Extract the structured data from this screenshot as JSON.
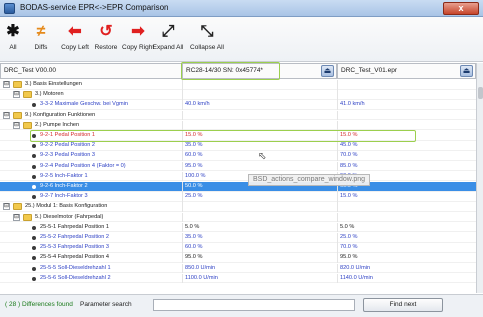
{
  "window": {
    "title": "BODAS-service EPR<->EPR Comparison",
    "close_glyph": "x"
  },
  "toolbar": {
    "buttons": [
      {
        "label": "All",
        "icon": "asterisk-icon",
        "glyph": "✱",
        "color": "#111111"
      },
      {
        "label": "Diffs",
        "icon": "not-equal-icon",
        "glyph": "≠",
        "color": "#e58a1b"
      },
      {
        "label": "Copy Left",
        "icon": "arrow-left-icon",
        "glyph": "⬅",
        "color": "#e02020"
      },
      {
        "label": "Restore",
        "icon": "restore-icon",
        "glyph": "↺",
        "color": "#e02020"
      },
      {
        "label": "Copy Right",
        "icon": "arrow-right-icon",
        "glyph": "➡",
        "color": "#e02020"
      },
      {
        "label": "Expand All",
        "icon": "expand-all-icon",
        "glyph": "⤢",
        "color": "#222222"
      },
      {
        "label": "Collapse All",
        "icon": "collapse-all-icon",
        "glyph": "⤡",
        "color": "#222222"
      }
    ]
  },
  "headers": {
    "tree": "DRC_Test V00.00",
    "left": "RC28-14/30 SN: 0x45774*",
    "right": "DRC_Test_V01.epr",
    "eject_glyph": "⏏"
  },
  "rows": [
    {
      "indent": 0,
      "kind": "group",
      "expander": "⊟",
      "label": "3.) Basis Einstellungen",
      "left": "",
      "right": "",
      "style": ""
    },
    {
      "indent": 1,
      "kind": "group",
      "expander": "⊟",
      "label": "3.) Motoren",
      "left": "",
      "right": "",
      "style": ""
    },
    {
      "indent": 2,
      "kind": "param",
      "label": "3-3-2 Maximale Geschw. bei Vgmin",
      "left": "40.0 km/h",
      "right": "41.0 km/h",
      "style": "blue"
    },
    {
      "indent": 0,
      "kind": "group",
      "expander": "⊟",
      "label": "9.) Konfiguration Funktionen",
      "left": "",
      "right": "",
      "style": ""
    },
    {
      "indent": 1,
      "kind": "group",
      "expander": "⊟",
      "label": "2.) Pumpe Inchen",
      "left": "",
      "right": "",
      "style": ""
    },
    {
      "indent": 2,
      "kind": "param",
      "label": "9-2-1 Pedal Position 1",
      "left": "15.0 %",
      "right": "15.0 %",
      "style": "red"
    },
    {
      "indent": 2,
      "kind": "param",
      "label": "9-2-2 Pedal Position 2",
      "left": "35.0 %",
      "right": "45.0 %",
      "style": "blue"
    },
    {
      "indent": 2,
      "kind": "param",
      "label": "9-2-3 Pedal Position 3",
      "left": "60.0 %",
      "right": "70.0 %",
      "style": "blue"
    },
    {
      "indent": 2,
      "kind": "param",
      "label": "9-2-4 Pedal Position 4 (Faktor = 0)",
      "left": "95.0 %",
      "right": "85.0 %",
      "style": "blue"
    },
    {
      "indent": 2,
      "kind": "param",
      "label": "9-2-5 Inch-Faktor 1",
      "left": "100.0 %",
      "right": "90.0 %",
      "style": "blue"
    },
    {
      "indent": 2,
      "kind": "param",
      "label": "9-2-6 Inch-Faktor 2",
      "left": "50.0 %",
      "right": "60.0 %",
      "style": "sel"
    },
    {
      "indent": 2,
      "kind": "param",
      "label": "9-2-7 Inch-Faktor 3",
      "left": "25.0 %",
      "right": "15.0 %",
      "style": "blue"
    },
    {
      "indent": 0,
      "kind": "group",
      "expander": "⊟",
      "label": "25.) Modul 1: Basis Konfiguration",
      "left": "",
      "right": "",
      "style": ""
    },
    {
      "indent": 1,
      "kind": "group",
      "expander": "⊟",
      "label": "5.) Dieselmotor (Fahrpedal)",
      "left": "",
      "right": "",
      "style": ""
    },
    {
      "indent": 2,
      "kind": "param",
      "label": "25-5-1 Fahrpedal Position 1",
      "left": "5.0 %",
      "right": "5.0 %",
      "style": ""
    },
    {
      "indent": 2,
      "kind": "param",
      "label": "25-5-2 Fahrpedal Position 2",
      "left": "35.0 %",
      "right": "25.0 %",
      "style": "blue"
    },
    {
      "indent": 2,
      "kind": "param",
      "label": "25-5-3 Fahrpedal Position 3",
      "left": "60.0 %",
      "right": "70.0 %",
      "style": "blue"
    },
    {
      "indent": 2,
      "kind": "param",
      "label": "25-5-4 Fahrpedal Position 4",
      "left": "95.0 %",
      "right": "95.0 %",
      "style": ""
    },
    {
      "indent": 2,
      "kind": "param",
      "label": "25-5-5 Soll-Dieseldrehzahl 1",
      "left": "850.0 U/min",
      "right": "820.0 U/min",
      "style": "blue"
    },
    {
      "indent": 2,
      "kind": "param",
      "label": "25-5-6 Soll-Dieseldrehzahl 2",
      "left": "1100.0 U/min",
      "right": "1140.0 U/min",
      "style": "blue"
    }
  ],
  "tooltip": "BSD_actions_compare_window.png",
  "status": {
    "count": "( 28 ) Differences found",
    "search_label": "Parameter search",
    "search_value": "",
    "find_label": "Find next"
  }
}
